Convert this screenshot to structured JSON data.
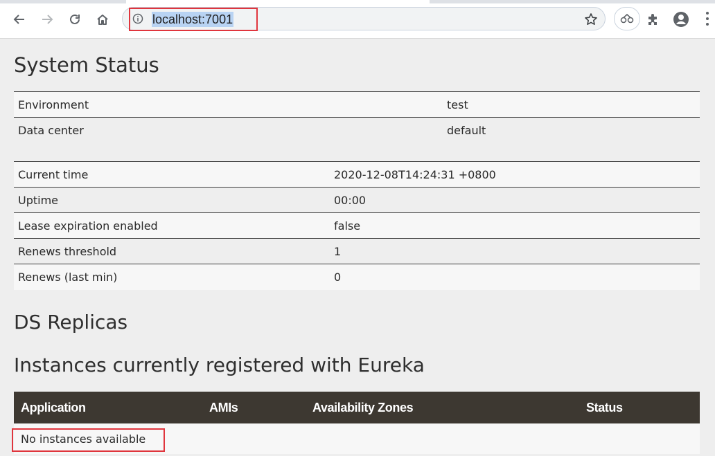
{
  "browser": {
    "url": "localhost:7001",
    "icons": {
      "back": "arrow-left-icon",
      "forward": "arrow-right-icon",
      "reload": "reload-icon",
      "home": "home-icon",
      "info": "info-icon",
      "bookmark": "star-icon",
      "extension_pill": "link-icon",
      "extensions": "puzzle-icon",
      "profile": "account-icon",
      "menu": "kebab-menu-icon"
    }
  },
  "system_status": {
    "title": "System Status",
    "table1": [
      {
        "label": "Environment",
        "value": "test"
      },
      {
        "label": "Data center",
        "value": "default"
      }
    ],
    "table2": [
      {
        "label": "Current time",
        "value": "2020-12-08T14:24:31 +0800"
      },
      {
        "label": "Uptime",
        "value": "00:00"
      },
      {
        "label": "Lease expiration enabled",
        "value": "false"
      },
      {
        "label": "Renews threshold",
        "value": "1"
      },
      {
        "label": "Renews (last min)",
        "value": "0"
      }
    ]
  },
  "ds_replicas": {
    "title": "DS Replicas"
  },
  "instances": {
    "title": "Instances currently registered with Eureka",
    "columns": [
      "Application",
      "AMIs",
      "Availability Zones",
      "Status"
    ],
    "empty_message": "No instances available"
  },
  "colors": {
    "table_header_bg": "#3d3831",
    "highlight_border": "#e0353d",
    "page_bg": "#eeeeee"
  }
}
